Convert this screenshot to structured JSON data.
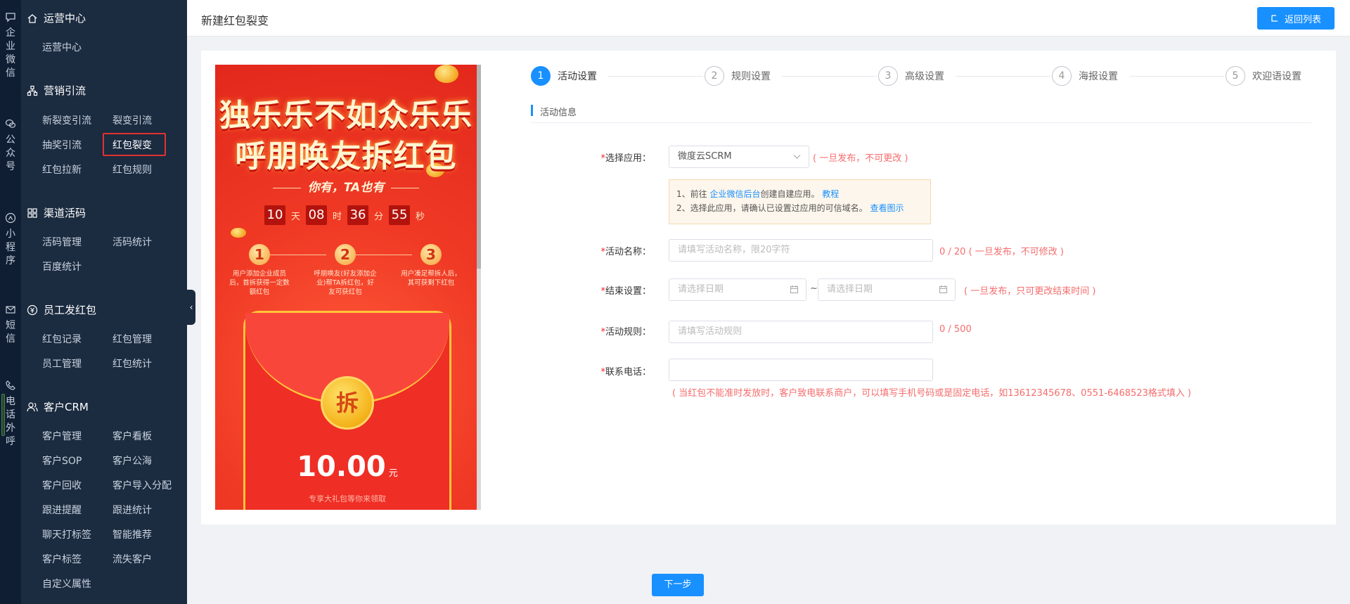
{
  "rail": [
    {
      "label": "企业微信",
      "icon": "chat-bubble-icon"
    },
    {
      "label": "公众号",
      "icon": "wechat-icon"
    },
    {
      "label": "小程序",
      "icon": "mini-program-icon"
    },
    {
      "label": "短信",
      "icon": "mail-icon"
    },
    {
      "label": "电话外呼",
      "icon": "phone-icon"
    }
  ],
  "sidebar": {
    "sections": [
      {
        "title": "运营中心",
        "icon": "home-icon",
        "items": [
          "运营中心"
        ]
      },
      {
        "title": "营销引流",
        "icon": "org-chart-icon",
        "items": [
          "新裂变引流",
          "裂变引流",
          "抽奖引流",
          "红包裂变",
          "红包拉新",
          "红包规则"
        ]
      },
      {
        "title": "渠道活码",
        "icon": "grid-icon",
        "items": [
          "活码管理",
          "活码统计",
          "百度统计"
        ]
      },
      {
        "title": "员工发红包",
        "icon": "coin-icon",
        "items": [
          "红包记录",
          "红包管理",
          "员工管理",
          "红包统计"
        ]
      },
      {
        "title": "客户CRM",
        "icon": "users-icon",
        "items": [
          "客户管理",
          "客户看板",
          "客户SOP",
          "客户公海",
          "客户回收",
          "客户导入分配",
          "跟进提醒",
          "跟进统计",
          "聊天打标签",
          "智能推荐",
          "客户标签",
          "流失客户",
          "自定义属性"
        ]
      }
    ],
    "active_item": "红包裂变"
  },
  "header": {
    "title": "新建红包裂变",
    "back_button": "返回列表"
  },
  "poster": {
    "headline1": "独乐乐不如众乐乐",
    "headline2": "呼朋唤友拆红包",
    "subtitle": "你有，TA也有",
    "countdown": [
      {
        "value": "10",
        "unit": "天"
      },
      {
        "value": "08",
        "unit": "时"
      },
      {
        "value": "36",
        "unit": "分"
      },
      {
        "value": "55",
        "unit": "秒"
      }
    ],
    "steps": [
      {
        "num": "1",
        "text": "用户添加企业成员后，首拆获得一定数额红包"
      },
      {
        "num": "2",
        "text": "呼朋唤友(好友添加企业)帮TA拆红包，好友可获红包"
      },
      {
        "num": "3",
        "text": "用户凑足帮拆人后，其可获剩下红包"
      }
    ],
    "coin_char": "拆",
    "amount": "10.00",
    "amount_unit": "元",
    "note": "专享大礼包等你来领取"
  },
  "stepper": [
    {
      "num": "1",
      "label": "活动设置",
      "active": true
    },
    {
      "num": "2",
      "label": "规则设置",
      "active": false
    },
    {
      "num": "3",
      "label": "高级设置",
      "active": false
    },
    {
      "num": "4",
      "label": "海报设置",
      "active": false
    },
    {
      "num": "5",
      "label": "欢迎语设置",
      "active": false
    }
  ],
  "section_title": "活动信息",
  "form": {
    "app": {
      "label": "选择应用：",
      "value": "微度云SCRM",
      "hint": "( 一旦发布，不可更改 )"
    },
    "tip": {
      "line1_prefix": "1、前往 ",
      "line1_link": "企业微信后台",
      "line1_mid": "创建自建应用。 ",
      "line1_link2": "教程",
      "line2_prefix": "2、选择此应用，请确认已设置过应用的可信域名。 ",
      "line2_link": "查看图示"
    },
    "name": {
      "label": "活动名称：",
      "placeholder": "请填写活动名称，限20字符",
      "hint": "0 / 20 ( 一旦发布，不可修改 )"
    },
    "end": {
      "label": "结束设置：",
      "start_placeholder": "请选择日期",
      "end_placeholder": "请选择日期",
      "sep": "~",
      "hint": "( 一旦发布，只可更改结束时间 )"
    },
    "rule": {
      "label": "活动规则：",
      "placeholder": "请填写活动规则",
      "hint": "0 / 500"
    },
    "phone": {
      "label": "联系电话：",
      "value": "",
      "hint": "( 当红包不能准时发放时，客户致电联系商户，可以填写手机号码或是固定电话，如13612345678、0551-6468523格式填入 )"
    }
  },
  "required_mark": "*",
  "next_button": "下一步",
  "colors": {
    "primary": "#1890ff",
    "sidebar": "#1b2b40",
    "rail": "#0f1e33",
    "warning": "#f56c6c",
    "active_outline": "#e0332f"
  }
}
